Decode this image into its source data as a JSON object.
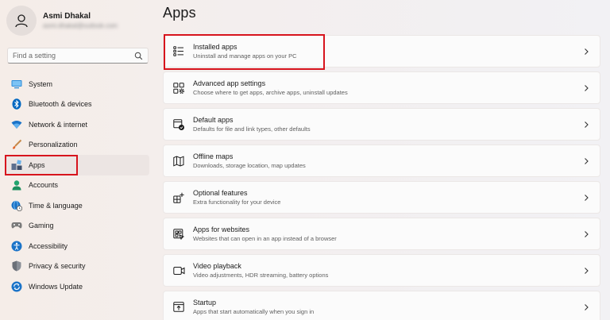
{
  "profile": {
    "name": "Asmi Dhakal",
    "email": "asmi.dhakal@outlook.com"
  },
  "search": {
    "placeholder": "Find a setting",
    "value": ""
  },
  "sidebar": {
    "items": [
      {
        "label": "System",
        "icon": "system-icon",
        "color": "#0078d4"
      },
      {
        "label": "Bluetooth & devices",
        "icon": "bluetooth-icon",
        "color": "#0067c0"
      },
      {
        "label": "Network & internet",
        "icon": "wifi-icon",
        "color": "#1a73c8"
      },
      {
        "label": "Personalization",
        "icon": "brush-icon",
        "color": "#d98b3a"
      },
      {
        "label": "Apps",
        "icon": "apps-icon",
        "color": "#5a6a8a",
        "active": true
      },
      {
        "label": "Accounts",
        "icon": "accounts-icon",
        "color": "#20a070"
      },
      {
        "label": "Time & language",
        "icon": "globe-clock-icon",
        "color": "#1a73c8"
      },
      {
        "label": "Gaming",
        "icon": "gamepad-icon",
        "color": "#7a7a7a"
      },
      {
        "label": "Accessibility",
        "icon": "accessibility-icon",
        "color": "#1a73c8"
      },
      {
        "label": "Privacy & security",
        "icon": "shield-icon",
        "color": "#7a7a7a"
      },
      {
        "label": "Windows Update",
        "icon": "update-icon",
        "color": "#1a73c8"
      }
    ]
  },
  "main": {
    "title": "Apps",
    "cards": [
      {
        "title": "Installed apps",
        "desc": "Uninstall and manage apps on your PC",
        "icon": "installed-apps-icon"
      },
      {
        "title": "Advanced app settings",
        "desc": "Choose where to get apps, archive apps, uninstall updates",
        "icon": "advanced-app-settings-icon"
      },
      {
        "title": "Default apps",
        "desc": "Defaults for file and link types, other defaults",
        "icon": "default-apps-icon"
      },
      {
        "title": "Offline maps",
        "desc": "Downloads, storage location, map updates",
        "icon": "map-icon"
      },
      {
        "title": "Optional features",
        "desc": "Extra functionality for your device",
        "icon": "optional-features-icon"
      },
      {
        "title": "Apps for websites",
        "desc": "Websites that can open in an app instead of a browser",
        "icon": "apps-for-websites-icon"
      },
      {
        "title": "Video playback",
        "desc": "Video adjustments, HDR streaming, battery options",
        "icon": "video-icon"
      },
      {
        "title": "Startup",
        "desc": "Apps that start automatically when you sign in",
        "icon": "startup-icon"
      }
    ]
  },
  "colors": {
    "highlight": "#d7141d",
    "accent": "#0067c0"
  }
}
